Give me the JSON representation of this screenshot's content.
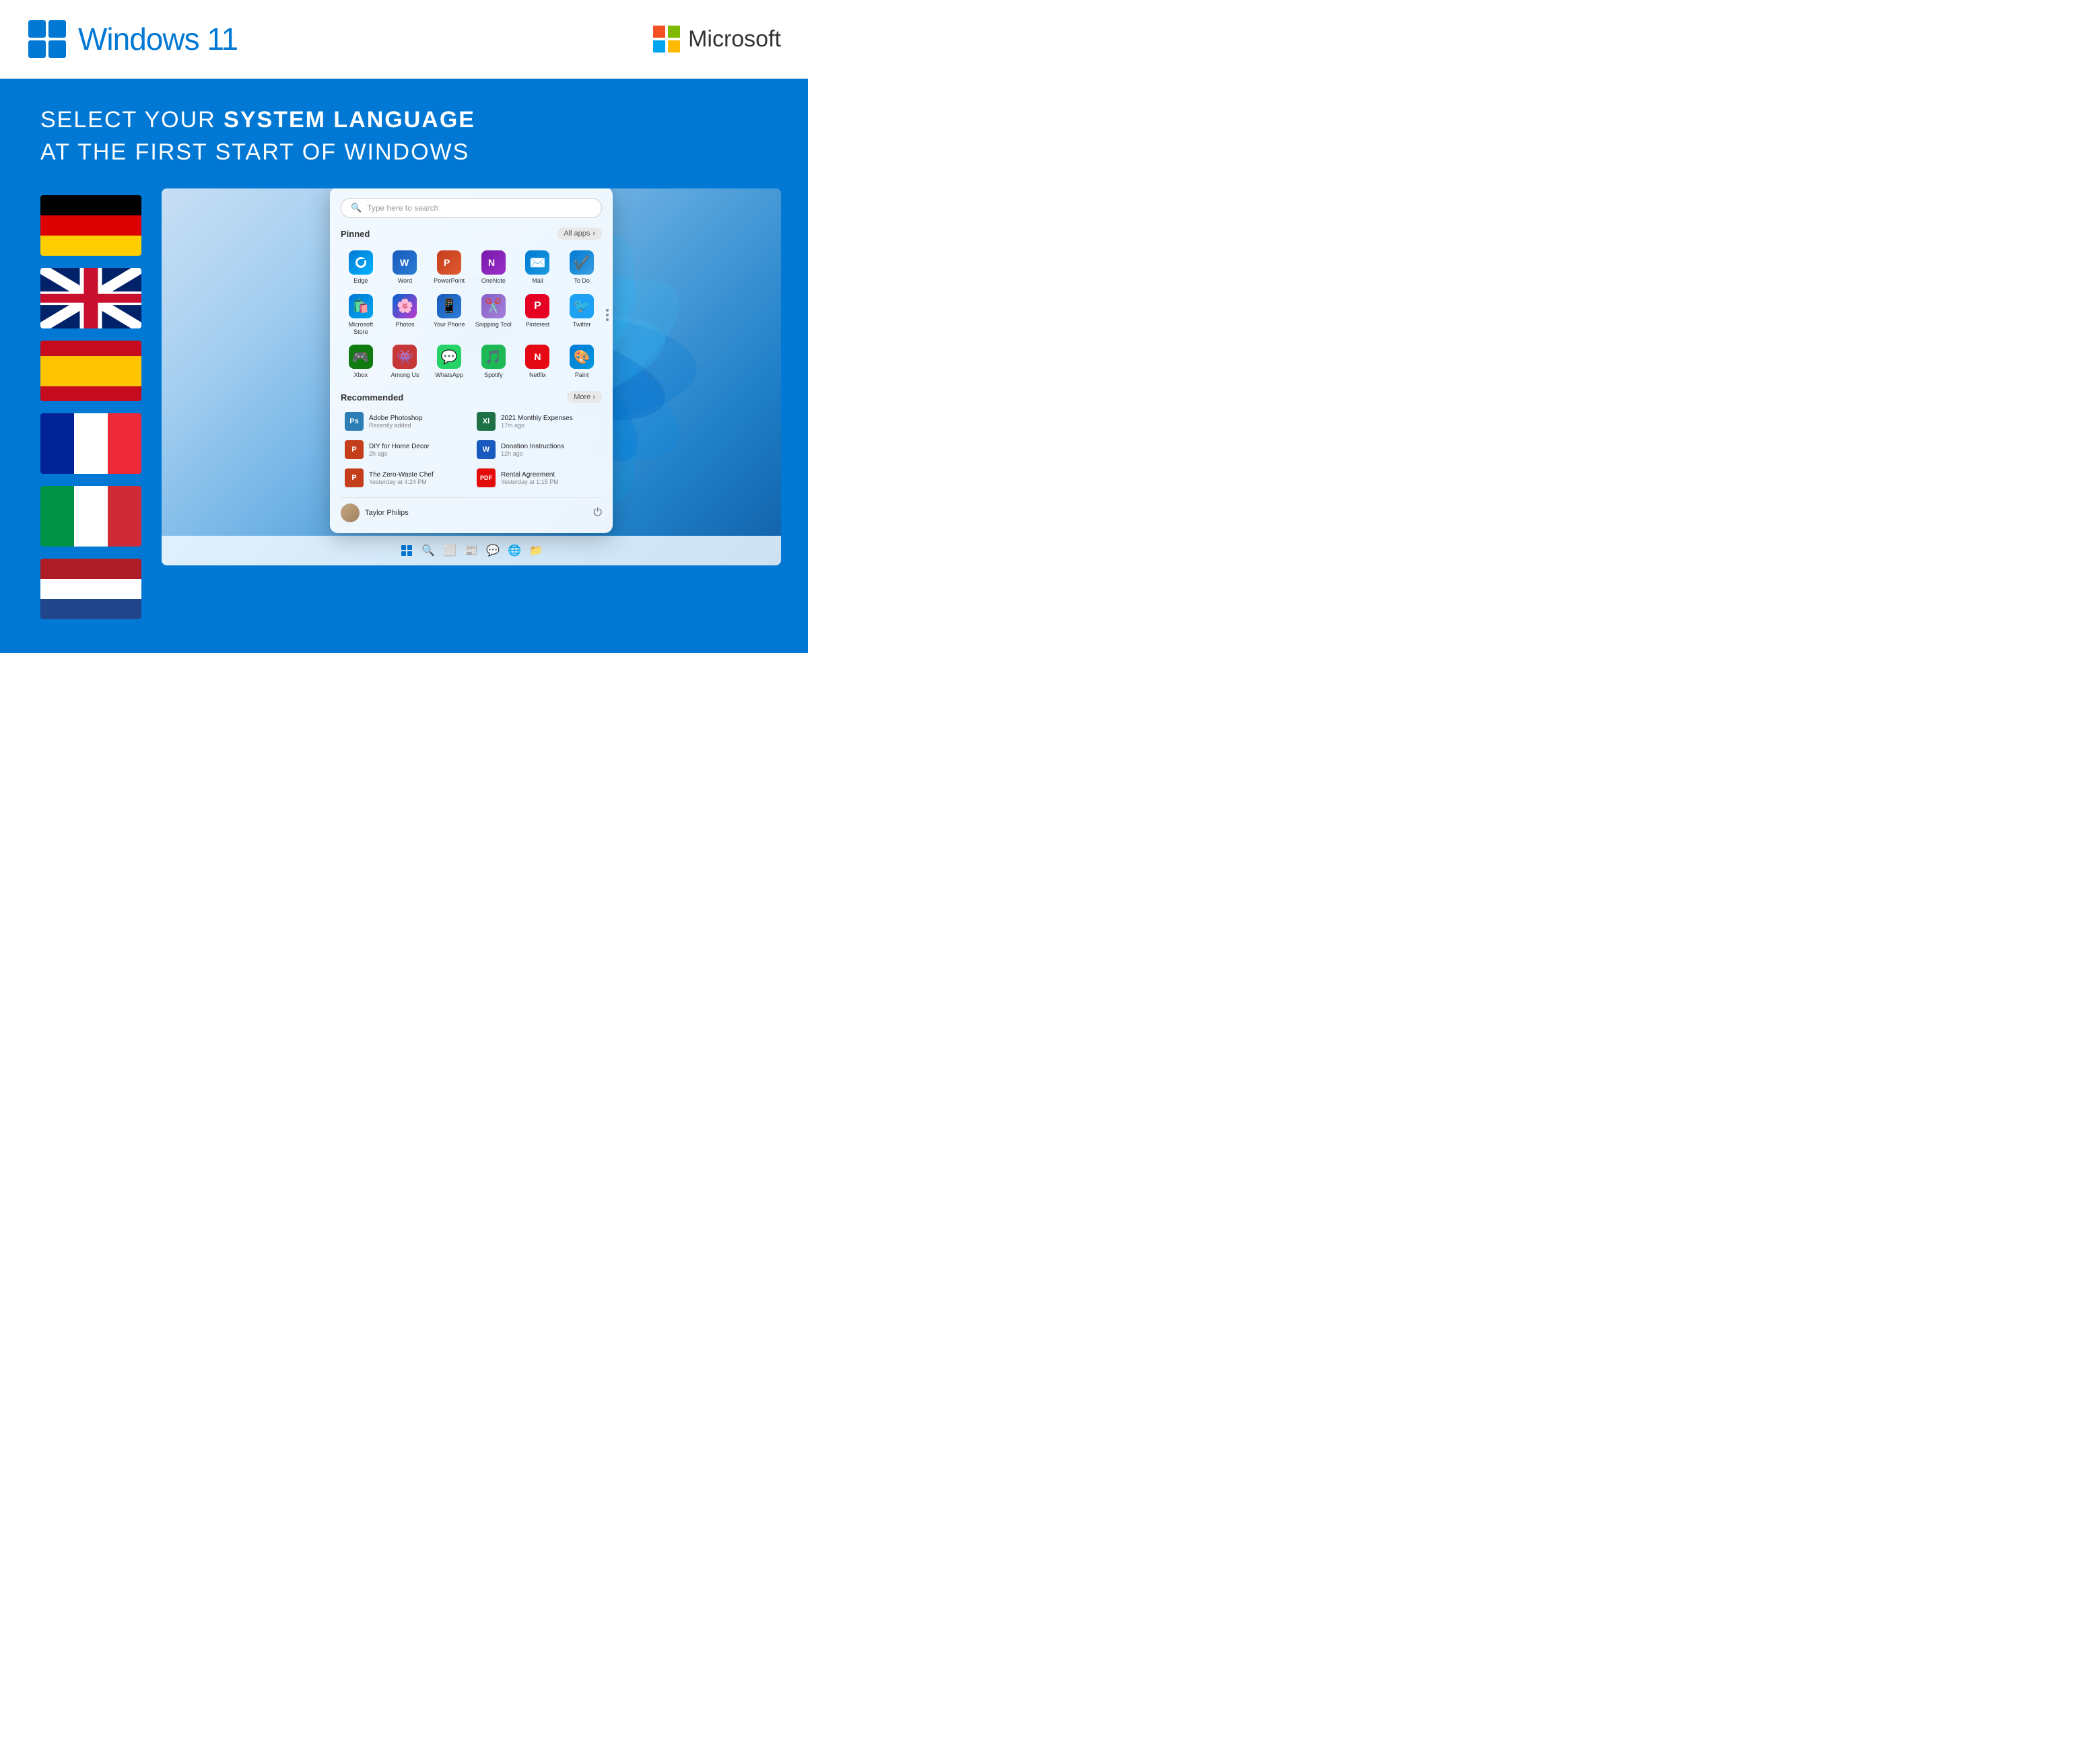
{
  "header": {
    "windows_logo_alt": "Windows logo",
    "windows_version": "Windows 11",
    "microsoft_logo_alt": "Microsoft logo",
    "microsoft_name": "Microsoft"
  },
  "headline": {
    "line1_normal": "SELECT YOUR ",
    "line1_bold": "SYSTEM LANGUAGE",
    "line2": "AT THE FIRST START OF WINDOWS"
  },
  "flags": [
    {
      "id": "de",
      "label": "German",
      "title": "Deutschland"
    },
    {
      "id": "uk",
      "label": "English",
      "title": "United Kingdom"
    },
    {
      "id": "es",
      "label": "Spanish",
      "title": "España"
    },
    {
      "id": "fr",
      "label": "French",
      "title": "France"
    },
    {
      "id": "it",
      "label": "Italian",
      "title": "Italia"
    },
    {
      "id": "nl",
      "label": "Dutch",
      "title": "Nederland"
    }
  ],
  "start_menu": {
    "search_placeholder": "Type here to search",
    "pinned_label": "Pinned",
    "all_apps_label": "All apps",
    "apps": [
      {
        "id": "edge",
        "label": "Edge",
        "icon": "edge"
      },
      {
        "id": "word",
        "label": "Word",
        "icon": "word"
      },
      {
        "id": "powerpoint",
        "label": "PowerPoint",
        "icon": "powerpoint"
      },
      {
        "id": "onenote",
        "label": "OneNote",
        "icon": "onenote"
      },
      {
        "id": "mail",
        "label": "Mail",
        "icon": "mail"
      },
      {
        "id": "todo",
        "label": "To Do",
        "icon": "todo"
      },
      {
        "id": "store",
        "label": "Microsoft Store",
        "icon": "store"
      },
      {
        "id": "photos",
        "label": "Photos",
        "icon": "photos"
      },
      {
        "id": "yourphone",
        "label": "Your Phone",
        "icon": "yourphone"
      },
      {
        "id": "snipping",
        "label": "Snipping Tool",
        "icon": "snipping"
      },
      {
        "id": "pinterest",
        "label": "Pinterest",
        "icon": "pinterest"
      },
      {
        "id": "twitter",
        "label": "Twitter",
        "icon": "twitter"
      },
      {
        "id": "xbox",
        "label": "Xbox",
        "icon": "xbox"
      },
      {
        "id": "among",
        "label": "Among Us",
        "icon": "among"
      },
      {
        "id": "whatsapp",
        "label": "WhatsApp",
        "icon": "whatsapp"
      },
      {
        "id": "spotify",
        "label": "Spotify",
        "icon": "spotify"
      },
      {
        "id": "netflix",
        "label": "Netflix",
        "icon": "netflix"
      },
      {
        "id": "paint",
        "label": "Paint",
        "icon": "paint"
      }
    ],
    "recommended_label": "Recommended",
    "more_label": "More",
    "recommended": [
      {
        "id": "photoshop",
        "label": "Adobe Photoshop",
        "time": "Recently added",
        "icon": "ps"
      },
      {
        "id": "expenses",
        "label": "2021 Monthly Expenses",
        "time": "17m ago",
        "icon": "xl"
      },
      {
        "id": "diy",
        "label": "DIY for Home Decor",
        "time": "2h ago",
        "icon": "pp"
      },
      {
        "id": "donation",
        "label": "Donation Instructions",
        "time": "12h ago",
        "icon": "wd"
      },
      {
        "id": "zerowaste",
        "label": "The Zero-Waste Chef",
        "time": "Yesterday at 4:24 PM",
        "icon": "pp"
      },
      {
        "id": "rental",
        "label": "Rental Agreement",
        "time": "Yesterday at 1:15 PM",
        "icon": "pdf"
      }
    ],
    "user_name": "Taylor Philips"
  },
  "colors": {
    "blue_bg": "#0078d4",
    "header_bg": "#ffffff",
    "win11_text": "#0078d4"
  }
}
